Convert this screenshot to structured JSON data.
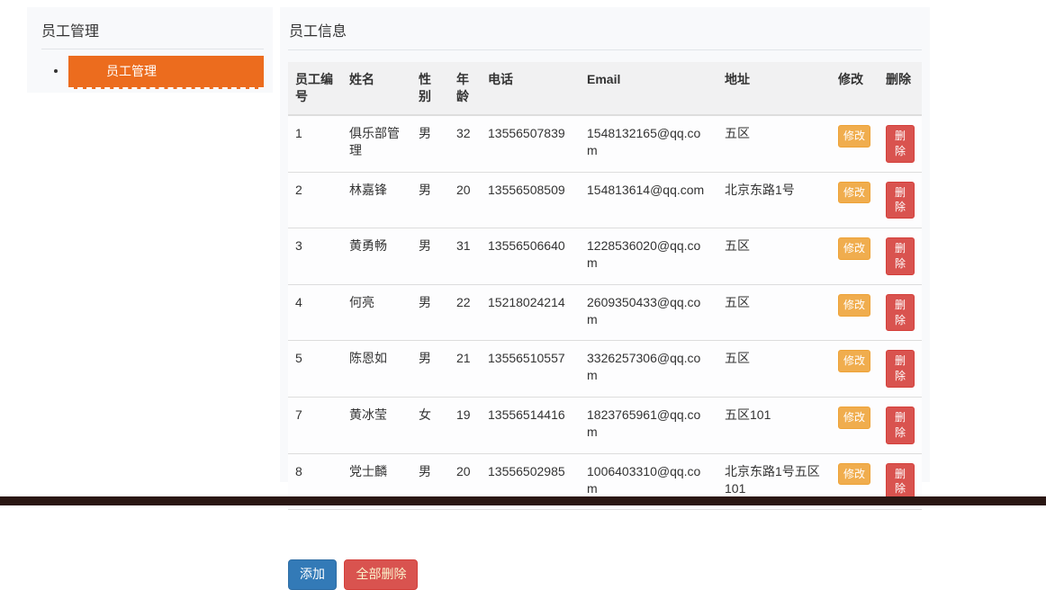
{
  "colors": {
    "accent_orange": "#ec6c1e",
    "primary_blue": "#337ab7",
    "warning_orange": "#f0ad4e",
    "danger_red": "#d9534f",
    "panel_background": "#f8f9fb",
    "footer_dark": "#2a1713"
  },
  "sidebar": {
    "title": "员工管理",
    "items": [
      {
        "label": "员工管理",
        "active": true
      }
    ]
  },
  "main": {
    "title": "员工信息",
    "table": {
      "headers": [
        "员工编号",
        "姓名",
        "性别",
        "年龄",
        "电话",
        "Email",
        "地址",
        "修改",
        "删除"
      ],
      "col_keys": [
        "id",
        "name",
        "gender",
        "age",
        "phone",
        "email",
        "address"
      ],
      "modify_button_label": "修改",
      "delete_button_label": "删除",
      "rows": [
        {
          "id": "1",
          "name": "俱乐部管理",
          "gender": "男",
          "age": "32",
          "phone": "13556507839",
          "email": "1548132165@qq.com",
          "address": "五区"
        },
        {
          "id": "2",
          "name": "林嘉锋",
          "gender": "男",
          "age": "20",
          "phone": "13556508509",
          "email": "154813614@qq.com",
          "address": "北京东路1号"
        },
        {
          "id": "3",
          "name": "黄勇畅",
          "gender": "男",
          "age": "31",
          "phone": "13556506640",
          "email": "1228536020@qq.com",
          "address": "五区"
        },
        {
          "id": "4",
          "name": "何亮",
          "gender": "男",
          "age": "22",
          "phone": "15218024214",
          "email": "2609350433@qq.com",
          "address": "五区"
        },
        {
          "id": "5",
          "name": "陈恩如",
          "gender": "男",
          "age": "21",
          "phone": "13556510557",
          "email": "3326257306@qq.com",
          "address": "五区"
        },
        {
          "id": "7",
          "name": "黄冰莹",
          "gender": "女",
          "age": "19",
          "phone": "13556514416",
          "email": "1823765961@qq.com",
          "address": "五区101"
        },
        {
          "id": "8",
          "name": "党士麟",
          "gender": "男",
          "age": "20",
          "phone": "13556502985",
          "email": "1006403310@qq.com",
          "address": "北京东路1号五区101"
        }
      ]
    },
    "buttons": {
      "add": "添加",
      "delete_all": "全部删除"
    }
  }
}
